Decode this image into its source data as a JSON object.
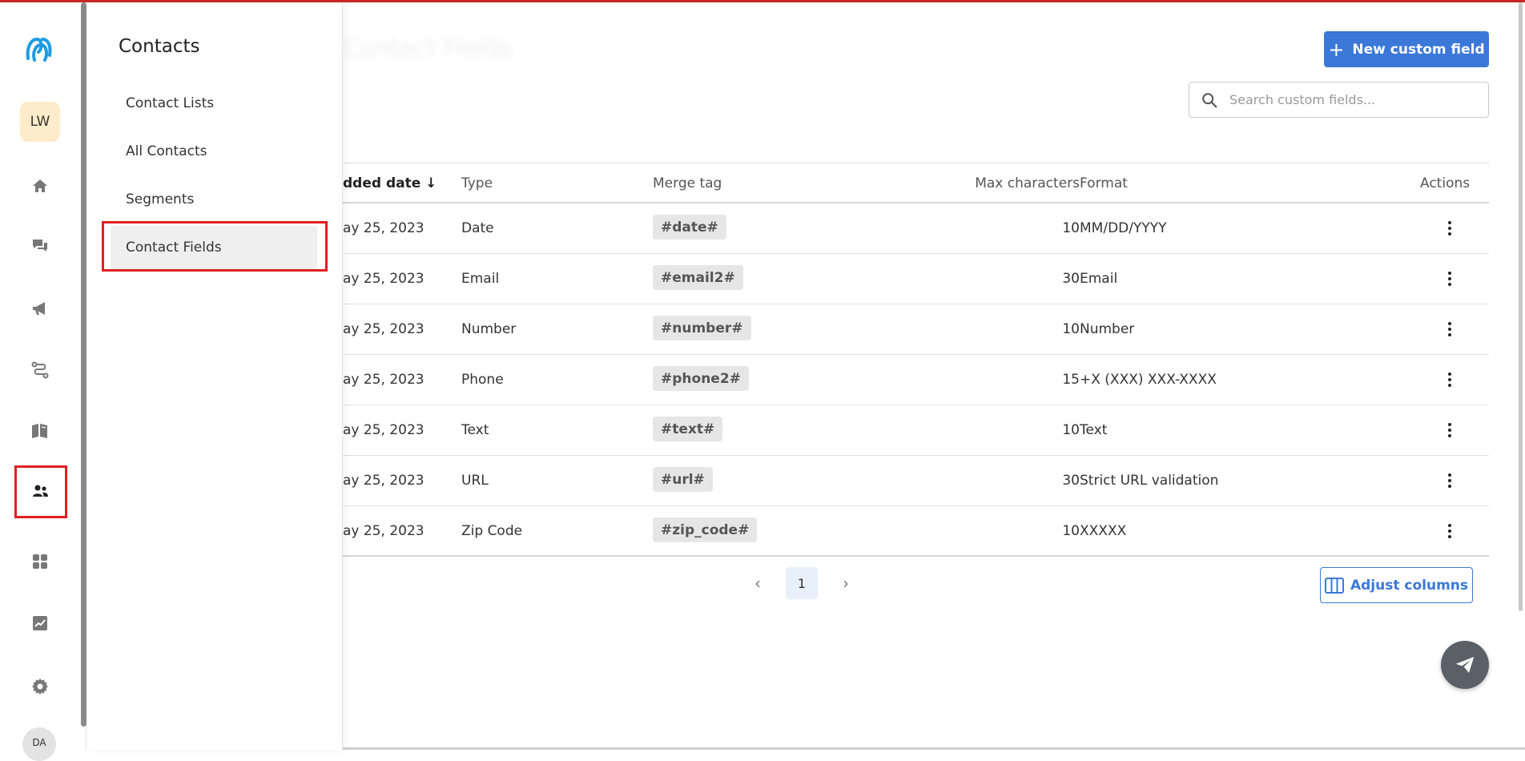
{
  "rail": {
    "workspace_initials": "LW",
    "user_initials": "DA",
    "icons": [
      "home-icon",
      "chat-icon",
      "megaphone-icon",
      "flow-icon",
      "book-icon",
      "contacts-icon",
      "apps-icon",
      "analytics-icon",
      "settings-icon"
    ]
  },
  "flyout": {
    "title": "Contacts",
    "items": [
      {
        "label": "Contact Lists"
      },
      {
        "label": "All Contacts"
      },
      {
        "label": "Segments"
      },
      {
        "label": "Contact Fields"
      }
    ]
  },
  "main": {
    "page_title": "Contact Fields",
    "new_button_label": "New custom field",
    "search_placeholder": "Search custom fields...",
    "columns": {
      "added": "dded date ↓",
      "type": "Type",
      "merge": "Merge tag",
      "max": "Max characters",
      "format": "Format",
      "actions": "Actions"
    },
    "rows": [
      {
        "date": "ay 25, 2023",
        "type": "Date",
        "tag": "#date#",
        "max": "10",
        "format": "MM/DD/YYYY"
      },
      {
        "date": "ay 25, 2023",
        "type": "Email",
        "tag": "#email2#",
        "max": "30",
        "format": "Email"
      },
      {
        "date": "ay 25, 2023",
        "type": "Number",
        "tag": "#number#",
        "max": "10",
        "format": "Number"
      },
      {
        "date": "ay 25, 2023",
        "type": "Phone",
        "tag": "#phone2#",
        "max": "15",
        "format": "+X (XXX) XXX-XXXX"
      },
      {
        "date": "ay 25, 2023",
        "type": "Text",
        "tag": "#text#",
        "max": "10",
        "format": "Text"
      },
      {
        "date": "ay 25, 2023",
        "type": "URL",
        "tag": "#url#",
        "max": "30",
        "format": "Strict URL validation"
      },
      {
        "date": "ay 25, 2023",
        "type": "Zip Code",
        "tag": "#zip_code#",
        "max": "10",
        "format": "XXXXX"
      }
    ],
    "pagination": {
      "current_page": "1"
    },
    "adjust_columns_label": "Adjust columns"
  },
  "colors": {
    "accent": "#3b78d8",
    "highlight": "#e02020",
    "workspace_badge": "#fdecc9"
  }
}
